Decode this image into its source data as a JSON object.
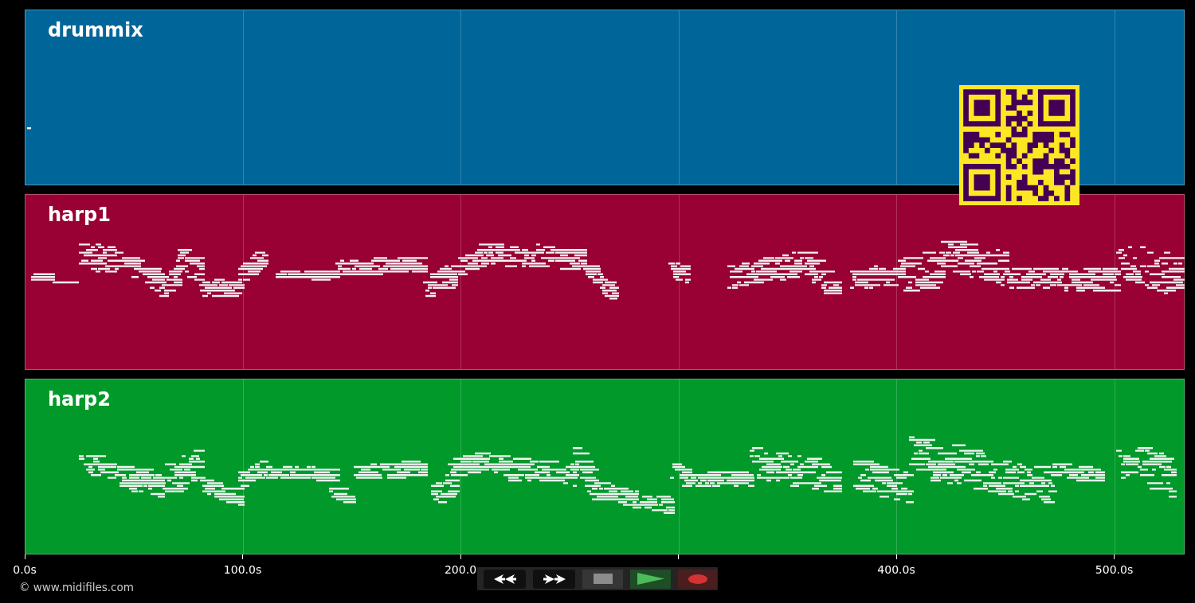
{
  "tracks": [
    {
      "name": "drummix",
      "color": "#006699"
    },
    {
      "name": "harp1",
      "color": "#990033"
    },
    {
      "name": "harp2",
      "color": "#00992a"
    }
  ],
  "time_axis": {
    "ticks": [
      {
        "kind": "labeled",
        "label": "0.0s"
      },
      {
        "kind": "labeled",
        "label": "100.0s"
      },
      {
        "kind": "labeled",
        "label": "200.0"
      },
      {
        "kind": "bare"
      },
      {
        "kind": "labeled",
        "label": "400.0s"
      },
      {
        "kind": "labeled",
        "label": "500.0s"
      }
    ]
  },
  "copyright": "© www.midifiles.com",
  "transport": {
    "buttons": [
      {
        "kind": "rewind"
      },
      {
        "kind": "fast_forward"
      },
      {
        "kind": "stop"
      },
      {
        "kind": "play"
      },
      {
        "kind": "record"
      }
    ]
  }
}
